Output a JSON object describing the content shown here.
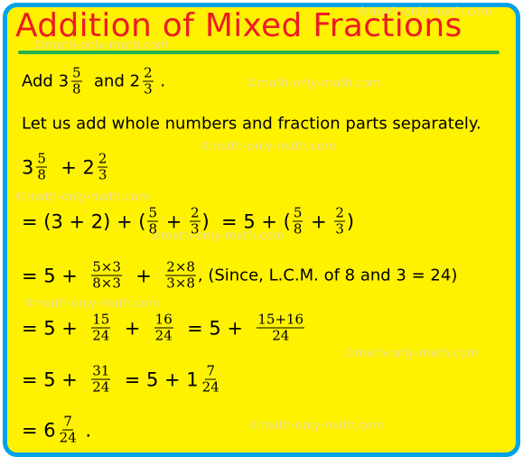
{
  "title": "Addition of Mixed Fractions",
  "colors": {
    "background": "#fff200",
    "border": "#00a2e8",
    "title": "#ed1c24",
    "underline": "#22b14c"
  },
  "watermark": "©math-only-math.com",
  "lines": [
    [
      {
        "t": "Add "
      },
      {
        "w": "3",
        "n": "5",
        "d": "8"
      },
      {
        "t": "  and "
      },
      {
        "w": "2",
        "n": "2",
        "d": "3"
      },
      {
        "t": " ."
      }
    ],
    [
      {
        "t": "Let us add whole numbers and fraction parts separately."
      }
    ],
    [
      {
        "w": "3",
        "n": "5",
        "d": "8"
      },
      {
        "t": "  + "
      },
      {
        "w": "2",
        "n": "2",
        "d": "3"
      }
    ],
    [
      {
        "t": "= (3 + 2) + ("
      },
      {
        "n": "5",
        "d": "8"
      },
      {
        "t": " + "
      },
      {
        "n": "2",
        "d": "3"
      },
      {
        "t": ")  = 5 + ("
      },
      {
        "n": "5",
        "d": "8"
      },
      {
        "t": " + "
      },
      {
        "n": "2",
        "d": "3"
      },
      {
        "t": ")"
      }
    ],
    [
      {
        "t": "= 5 +  "
      },
      {
        "n": "5×3",
        "d": "8×3"
      },
      {
        "t": "  +  "
      },
      {
        "n": "2×8",
        "d": "3×8"
      },
      {
        "t": ", (Since, L.C.M. of 8 and 3 = 24)",
        "small": true
      }
    ],
    [
      {
        "t": "= 5 +  "
      },
      {
        "n": "15",
        "d": "24"
      },
      {
        "t": "  +  "
      },
      {
        "n": "16",
        "d": "24"
      },
      {
        "t": "  = 5 +  "
      },
      {
        "n": "15+16",
        "d": "24"
      }
    ],
    [
      {
        "t": "= 5 +  "
      },
      {
        "n": "31",
        "d": "24"
      },
      {
        "t": "  = 5 + "
      },
      {
        "w": "1",
        "n": "7",
        "d": "24"
      }
    ],
    [
      {
        "t": "= "
      },
      {
        "w": "6",
        "n": "7",
        "d": "24"
      },
      {
        "t": " ."
      }
    ]
  ]
}
